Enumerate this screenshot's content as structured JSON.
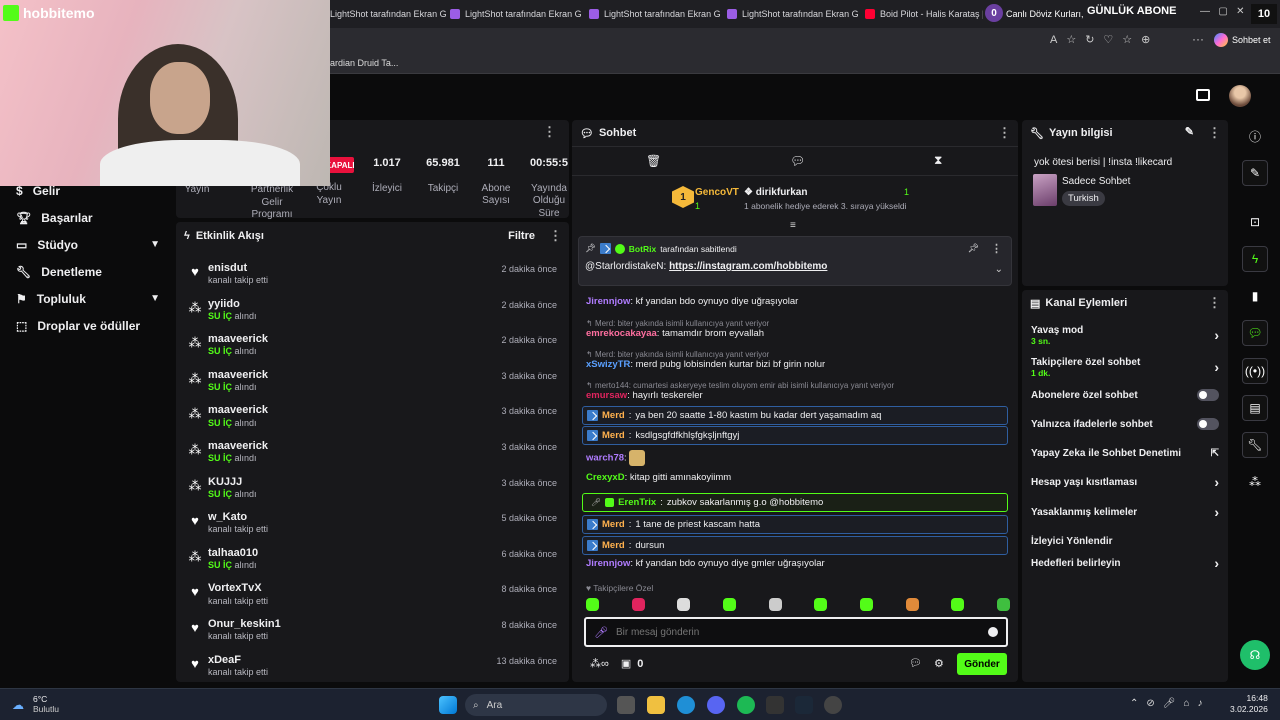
{
  "browser": {
    "tabs": [
      {
        "label": "LightShot tarafından Ekran G",
        "icon": "lightshot-icon"
      },
      {
        "label": "LightShot tarafından Ekran G",
        "icon": "lightshot-icon"
      },
      {
        "label": "LightShot tarafından Ekran G",
        "icon": "lightshot-icon"
      },
      {
        "label": "LightShot tarafından Ekran G",
        "icon": "lightshot-icon"
      },
      {
        "label": "Boid Pilot - Halis Karataş | 1!",
        "icon": "youtube-icon"
      },
      {
        "label": "Canlı Döviz Kurları,",
        "icon": "exchange-icon"
      }
    ],
    "overlay_banner": "GÜNLÜK ABONE",
    "overlay_count_left": "0",
    "overlay_count_right": "10",
    "bookmark": "ardian Druid Ta...",
    "copilot_label": "Sohbet et"
  },
  "stream_overlay": {
    "logo": "hobbitemo"
  },
  "sidebar": {
    "items": [
      {
        "label": "Gelir",
        "icon": "dollar-icon",
        "expand": false
      },
      {
        "label": "Başarılar",
        "icon": "trophy-icon",
        "expand": false
      },
      {
        "label": "Stüdyo",
        "icon": "studio-icon",
        "expand": true
      },
      {
        "label": "Denetleme",
        "icon": "wrench-icon",
        "expand": false
      },
      {
        "label": "Topluluk",
        "icon": "community-icon",
        "expand": true
      },
      {
        "label": "Droplar ve ödüller",
        "icon": "drops-icon",
        "expand": false
      }
    ]
  },
  "stats": {
    "status_badge": "KAPALI",
    "items": [
      {
        "value": "",
        "label": "Yayın"
      },
      {
        "value": "",
        "label": "Partnerlik Gelir Programı"
      },
      {
        "value": "",
        "label": "Çoklu Yayın"
      },
      {
        "value": "1.017",
        "label": "İzleyici"
      },
      {
        "value": "65.981",
        "label": "Takipçi"
      },
      {
        "value": "111",
        "label": "Abone Sayısı"
      },
      {
        "value": "00:55:5",
        "label": "Yayında Olduğu Süre"
      }
    ]
  },
  "activity": {
    "title": "Etkinlik Akışı",
    "filter_label": "Filtre",
    "items": [
      {
        "name": "enisdut",
        "desc": "kanalı takip etti",
        "time": "2 dakika önce",
        "type": "follow"
      },
      {
        "name": "yyiido",
        "desc_prefix": "SU İÇ",
        "desc": "alındı",
        "time": "2 dakika önce",
        "type": "reward"
      },
      {
        "name": "maaveerick",
        "desc_prefix": "SU İÇ",
        "desc": "alındı",
        "time": "2 dakika önce",
        "type": "reward"
      },
      {
        "name": "maaveerick",
        "desc_prefix": "SU İÇ",
        "desc": "alındı",
        "time": "3 dakika önce",
        "type": "reward"
      },
      {
        "name": "maaveerick",
        "desc_prefix": "SU İÇ",
        "desc": "alındı",
        "time": "3 dakika önce",
        "type": "reward"
      },
      {
        "name": "maaveerick",
        "desc_prefix": "SU İÇ",
        "desc": "alındı",
        "time": "3 dakika önce",
        "type": "reward"
      },
      {
        "name": "KUJJJ",
        "desc_prefix": "SU İÇ",
        "desc": "alındı",
        "time": "3 dakika önce",
        "type": "reward"
      },
      {
        "name": "w_Kato",
        "desc": "kanalı takip etti",
        "time": "5 dakika önce",
        "type": "follow"
      },
      {
        "name": "talhaa010",
        "desc_prefix": "SU İÇ",
        "desc": "alındı",
        "time": "6 dakika önce",
        "type": "reward"
      },
      {
        "name": "VortexTvX",
        "desc": "kanalı takip etti",
        "time": "8 dakika önce",
        "type": "follow"
      },
      {
        "name": "Onur_keskin1",
        "desc": "kanalı takip etti",
        "time": "8 dakika önce",
        "type": "follow"
      },
      {
        "name": "xDeaF",
        "desc": "kanalı takip etti",
        "time": "13 dakika önce",
        "type": "follow"
      }
    ]
  },
  "chat": {
    "title": "Sohbet",
    "leader": {
      "name": "GencoVT",
      "rank": "1",
      "count": "1"
    },
    "gifter": {
      "name": "dirikfurkan",
      "count": "1",
      "desc": "1 abonelik hediye ederek 3. sıraya yükseldi"
    },
    "pinned": {
      "by_prefix": "BotRix",
      "by_suffix": "tarafından sabitlendi",
      "user": "@StarlordistakeN",
      "link": "https://instagram.com/hobbitemo"
    },
    "messages": [
      {
        "kind": "plain",
        "user": "Jirennjow",
        "color": "#b07cff",
        "text": "kf yandan bdo oynuyo diye uğraşıyolar"
      },
      {
        "kind": "reply",
        "reply_to": "Merd: biter yakında isimli kullanıcıya yanıt veriyor",
        "user": "emrekocakayaa",
        "color": "#ff6fa0",
        "text": "tamamdır brom eyvallah"
      },
      {
        "kind": "reply",
        "reply_to": "Merd: biter yakında isimli kullanıcıya yanıt veriyor",
        "user": "xSwizyTR",
        "color": "#5aa0ff",
        "text": "merd pubg lobisinden kurtar bizi bf girin nolur"
      },
      {
        "kind": "reply",
        "reply_to": "merto144: cumartesi askeryeye teslim oluyom emir abi isimli kullanıcıya yanıt veriyor",
        "user": "emursaw",
        "color": "#e0245e",
        "text": "hayırlı teskereler"
      },
      {
        "kind": "mod",
        "user": "Merd",
        "color": "#ffb14e",
        "text": "ya ben 20 saatte 1-80 kastım bu kadar dert yaşamadım aq"
      },
      {
        "kind": "mod",
        "user": "Merd",
        "color": "#ffb14e",
        "text": "ksdlgsgfdfkhlşfgkşljnftgyj"
      },
      {
        "kind": "emote",
        "user": "warch78",
        "color": "#b07cff",
        "text": ""
      },
      {
        "kind": "plain",
        "user": "CrexyxD",
        "color": "#53fc18",
        "text": "kitap gitti amınakoyiimm"
      },
      {
        "kind": "sub",
        "user": "ErenTrix",
        "color": "#53fc18",
        "text": "zubkov sakarlanmış g.o @hobbitemo"
      },
      {
        "kind": "mod",
        "user": "Merd",
        "color": "#ffb14e",
        "text": "1 tane de priest kascam hatta"
      },
      {
        "kind": "mod",
        "user": "Merd",
        "color": "#ffb14e",
        "text": "dursun"
      },
      {
        "kind": "plain",
        "user": "Jirennjow",
        "color": "#b07cff",
        "text": "kf yandan bdo oynuyo diye gmler uğraşıyolar"
      }
    ],
    "followers_only_label": "Takipçilere Özel",
    "input_placeholder": "Bir mesaj gönderin",
    "points": "0",
    "send_label": "Gönder"
  },
  "stream_info": {
    "title": "Yayın bilgisi",
    "stream_title": "yok ötesi berisi | !insta !likecard",
    "category": "Sadece Sohbet",
    "language": "Turkish"
  },
  "channel_actions": {
    "title": "Kanal Eylemleri",
    "items": [
      {
        "label": "Yavaş mod",
        "sub": "3 sn.",
        "control": "chevron"
      },
      {
        "label": "Takipçilere özel sohbet",
        "sub": "1 dk.",
        "control": "chevron"
      },
      {
        "label": "Abonelere özel sohbet",
        "sub": "",
        "control": "toggle"
      },
      {
        "label": "Yalnızca ifadelerle sohbet",
        "sub": "",
        "control": "toggle"
      },
      {
        "label": "Yapay Zeka ile Sohbet Denetimi",
        "sub": "",
        "control": "external"
      },
      {
        "label": "Hesap yaşı kısıtlaması",
        "sub": "",
        "control": "chevron"
      },
      {
        "label": "Yasaklanmış kelimeler",
        "sub": "",
        "control": "chevron"
      },
      {
        "label": "İzleyici Yönlendir",
        "sub": "",
        "control": "none"
      },
      {
        "label": "Hedefleri belirleyin",
        "sub": "",
        "control": "chevron"
      }
    ]
  },
  "taskbar": {
    "weather_temp": "6°C",
    "weather_desc": "Bulutlu",
    "search_label": "Ara",
    "time": "16:48",
    "date": "3.02.2026"
  },
  "colors": {
    "accent": "#53fc18",
    "panel": "#18181b",
    "background": "#0b0b0c",
    "live_red": "#e9113c"
  }
}
